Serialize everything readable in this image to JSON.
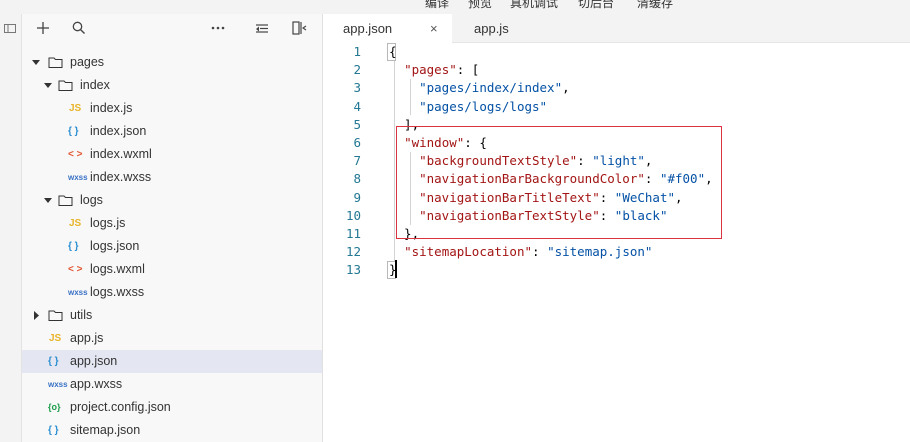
{
  "menubar": {
    "items": [
      "编译",
      "预览",
      "真机调试",
      "切后台",
      "清缓存"
    ]
  },
  "explorer": {
    "toolbar": {
      "add": "add-icon",
      "search": "search-icon",
      "more": "more-icon",
      "collapse": "collapse-icon",
      "split": "split-icon"
    },
    "tree": [
      {
        "label": "pages",
        "kind": "folder",
        "open": true
      },
      {
        "label": "index",
        "kind": "folder",
        "open": true
      },
      {
        "label": "index.js",
        "kind": "js",
        "badge": "JS"
      },
      {
        "label": "index.json",
        "kind": "json",
        "badge": "{ }"
      },
      {
        "label": "index.wxml",
        "kind": "wxml",
        "badge": "< >"
      },
      {
        "label": "index.wxss",
        "kind": "wxss",
        "badge": "wxss"
      },
      {
        "label": "logs",
        "kind": "folder",
        "open": true
      },
      {
        "label": "logs.js",
        "kind": "js",
        "badge": "JS"
      },
      {
        "label": "logs.json",
        "kind": "json",
        "badge": "{ }"
      },
      {
        "label": "logs.wxml",
        "kind": "wxml",
        "badge": "< >"
      },
      {
        "label": "logs.wxss",
        "kind": "wxss",
        "badge": "wxss"
      },
      {
        "label": "utils",
        "kind": "folder",
        "open": false
      },
      {
        "label": "app.js",
        "kind": "js",
        "badge": "JS"
      },
      {
        "label": "app.json",
        "kind": "json",
        "badge": "{ }",
        "selected": true
      },
      {
        "label": "app.wxss",
        "kind": "wxss",
        "badge": "wxss"
      },
      {
        "label": "project.config.json",
        "kind": "config",
        "badge": "{o}"
      },
      {
        "label": "sitemap.json",
        "kind": "json",
        "badge": "{ }"
      }
    ]
  },
  "tabs": [
    {
      "label": "app.json",
      "active": true,
      "close": "×"
    },
    {
      "label": "app.js",
      "active": false
    }
  ],
  "editor": {
    "line_numbers": [
      "1",
      "2",
      "3",
      "4",
      "5",
      "6",
      "7",
      "8",
      "9",
      "10",
      "11",
      "12",
      "13"
    ],
    "lines": [
      "{",
      "  \"pages\": [",
      "    \"pages/index/index\",",
      "    \"pages/logs/logs\"",
      "  ],",
      "  \"window\": {",
      "    \"backgroundTextStyle\": \"light\",",
      "    \"navigationBarBackgroundColor\": \"#f00\",",
      "    \"navigationBarTitleText\": \"WeChat\",",
      "    \"navigationBarTextStyle\": \"black\"",
      "  },",
      "  \"sitemapLocation\": \"sitemap.json\"",
      "}"
    ]
  },
  "colors": {
    "json_key": "#a31515",
    "json_string": "#0451a5",
    "line_number": "#237893",
    "highlight_box": "#d9333f",
    "js_icon": "#e8b52a",
    "json_icon": "#2c8fd1",
    "wxml_icon": "#e2542f",
    "wxss_icon": "#3a72c5",
    "config_icon": "#1c9c4b",
    "selection": "#e4e6f1"
  }
}
